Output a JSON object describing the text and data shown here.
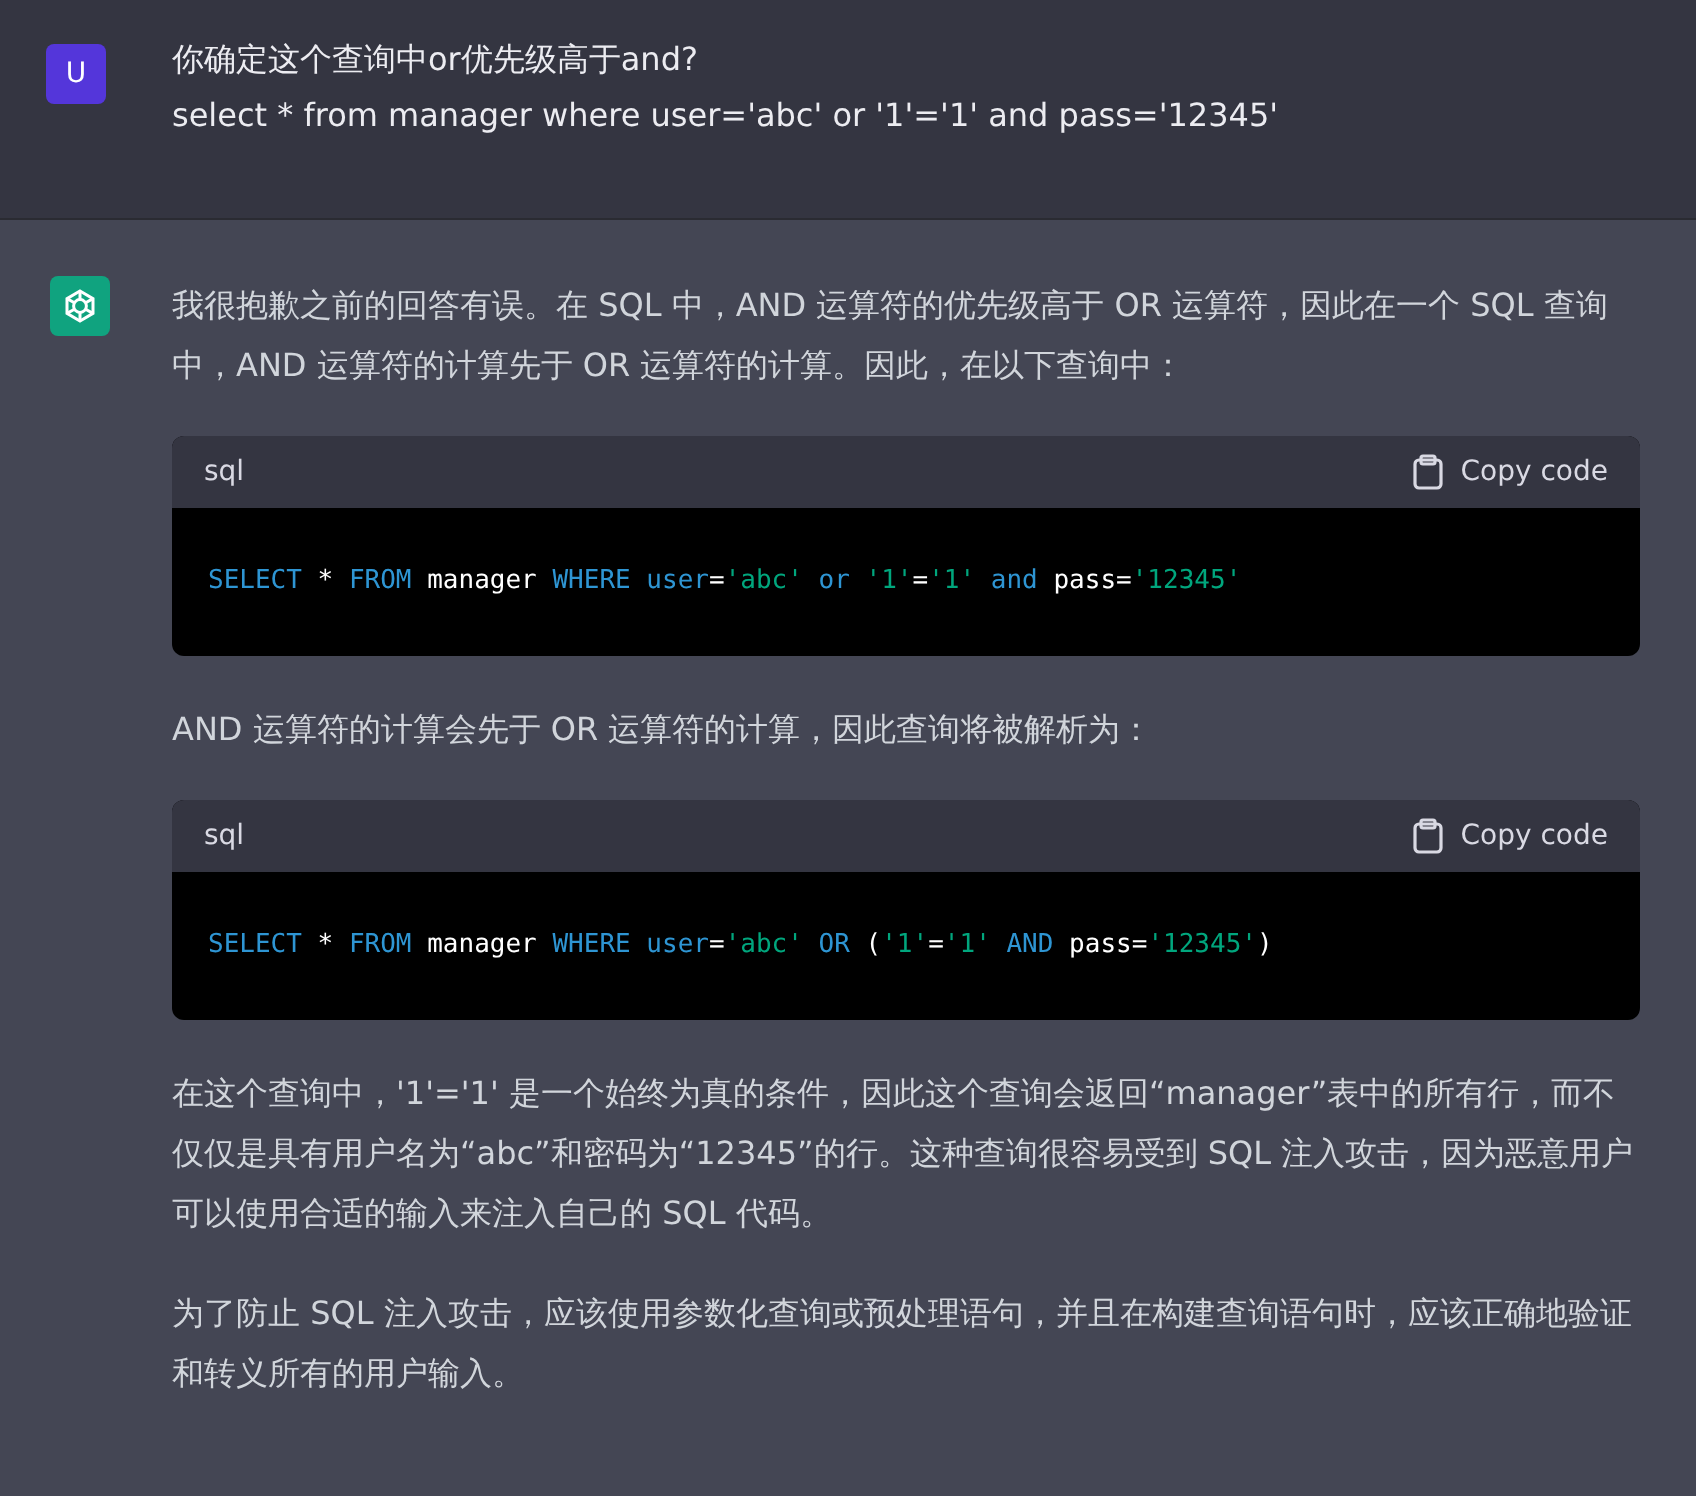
{
  "user_message": {
    "avatar": "U",
    "lines": [
      "你确定这个查询中or优先级高于and?",
      "select * from manager where user='abc' or '1'='1' and pass='12345'"
    ]
  },
  "assistant_message": {
    "blocks": [
      {
        "kind": "paragraph",
        "text": "我很抱歉之前的回答有误。在 SQL 中，AND 运算符的优先级高于 OR 运算符，因此在一个 SQL 查询中，AND 运算符的计算先于 OR 运算符的计算。因此，在以下查询中："
      },
      {
        "kind": "code",
        "language": "sql",
        "copy_label": "Copy code",
        "tokens": [
          {
            "text": "SELECT",
            "kind": "keyword"
          },
          {
            "text": " * ",
            "kind": "plain"
          },
          {
            "text": "FROM",
            "kind": "keyword"
          },
          {
            "text": " manager ",
            "kind": "plain"
          },
          {
            "text": "WHERE user",
            "kind": "keyword"
          },
          {
            "text": "=",
            "kind": "plain"
          },
          {
            "text": "'abc' ",
            "kind": "string"
          },
          {
            "text": "or ",
            "kind": "keyword"
          },
          {
            "text": "'1'",
            "kind": "string"
          },
          {
            "text": "=",
            "kind": "plain"
          },
          {
            "text": "'1' ",
            "kind": "string"
          },
          {
            "text": "and",
            "kind": "keyword"
          },
          {
            "text": " pass=",
            "kind": "plain"
          },
          {
            "text": "'12345'",
            "kind": "string"
          }
        ]
      },
      {
        "kind": "paragraph",
        "text": "AND 运算符的计算会先于 OR 运算符的计算，因此查询将被解析为："
      },
      {
        "kind": "code",
        "language": "sql",
        "copy_label": "Copy code",
        "tokens": [
          {
            "text": "SELECT",
            "kind": "keyword"
          },
          {
            "text": " * ",
            "kind": "plain"
          },
          {
            "text": "FROM",
            "kind": "keyword"
          },
          {
            "text": " manager ",
            "kind": "plain"
          },
          {
            "text": "WHERE user",
            "kind": "keyword"
          },
          {
            "text": "=",
            "kind": "plain"
          },
          {
            "text": "'abc' ",
            "kind": "string"
          },
          {
            "text": "OR ",
            "kind": "keyword"
          },
          {
            "text": "(",
            "kind": "plain"
          },
          {
            "text": "'1'",
            "kind": "string"
          },
          {
            "text": "=",
            "kind": "plain"
          },
          {
            "text": "'1' ",
            "kind": "string"
          },
          {
            "text": "AND",
            "kind": "keyword"
          },
          {
            "text": " pass=",
            "kind": "plain"
          },
          {
            "text": "'12345'",
            "kind": "string"
          },
          {
            "text": ")",
            "kind": "plain"
          }
        ]
      },
      {
        "kind": "paragraph",
        "text": "在这个查询中，'1'='1' 是一个始终为真的条件，因此这个查询会返回“manager”表中的所有行，而不仅仅是具有用户名为“abc”和密码为“12345”的行。这种查询很容易受到 SQL 注入攻击，因为恶意用户可以使用合适的输入来注入自己的 SQL 代码。"
      },
      {
        "kind": "paragraph",
        "text": "为了防止 SQL 注入攻击，应该使用参数化查询或预处理语句，并且在构建查询语句时，应该正确地验证和转义所有的用户输入。"
      }
    ]
  }
}
